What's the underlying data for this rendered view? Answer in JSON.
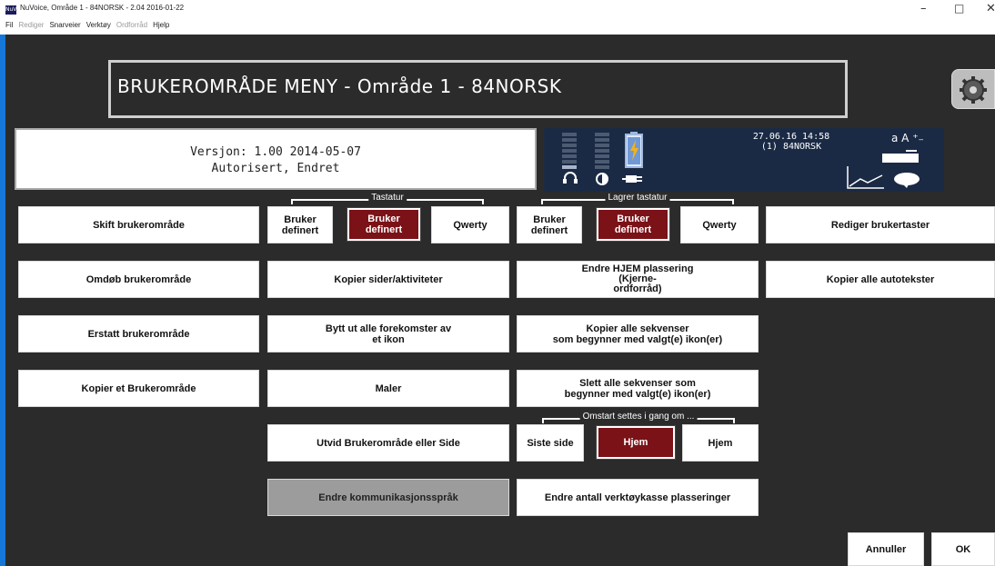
{
  "window": {
    "title": "NuVoice, Område 1 - 84NORSK - 2.04 2016-01-22",
    "icon_text": "NuV",
    "minimize": "–",
    "maximize": "□",
    "close": "✕"
  },
  "menubar": {
    "items": [
      "Fil",
      "Rediger",
      "Snarveier",
      "Verktøy",
      "Ordforråd",
      "Hjelp"
    ],
    "disabled": [
      "Rediger",
      "Ordforråd"
    ]
  },
  "header": {
    "title": "BRUKEROMRÅDE MENY - Område 1 - 84NORSK"
  },
  "version": {
    "line1": "Versjon: 1.00 2014-05-07",
    "line2": "Autorisert, Endret"
  },
  "status": {
    "date": "27.06.16 14:58",
    "user": "(1) 84NORSK",
    "size_icon": "a A ⁺₋"
  },
  "groups": {
    "tastatur": "Tastatur",
    "lagrer_tastatur": "Lagrer tastatur",
    "omstart": "Omstart settes i gang om ..."
  },
  "buttons": {
    "skift": "Skift brukerområde",
    "omdop": "Omdøb brukerområde",
    "erstatt": "Erstatt brukerområde",
    "kopier_omrade": "Kopier et Brukerområde",
    "t_bruker1": "Bruker\ndefinert",
    "t_bruker2": "Bruker\ndefinert",
    "t_qwerty": "Qwerty",
    "kopier_sider": "Kopier sider/aktiviteter",
    "bytt_ut": "Bytt ut alle forekomster av\net ikon",
    "maler": "Maler",
    "utvid": "Utvid Brukerområde eller Side",
    "endre_sprak": "Endre kommunikasjonsspråk",
    "l_bruker1": "Bruker\ndefinert",
    "l_bruker2": "Bruker\ndefinert",
    "l_qwerty": "Qwerty",
    "endre_hjem": "Endre HJEM plassering\n(Kjerne-\nordforråd)",
    "kopier_sekv": "Kopier alle sekvenser\nsom begynner med valgt(e) ikon(er)",
    "slett_sekv": "Slett alle sekvenser som\nbegynner med valgt(e) ikon(er)",
    "siste_side": "Siste side",
    "hjem1": "Hjem",
    "hjem2": "Hjem",
    "endre_antall": "Endre antall verktøykasse plasseringer",
    "rediger_taster": "Rediger brukertaster",
    "kopier_auto": "Kopier alle autotekster",
    "annuller": "Annuller",
    "ok": "OK"
  },
  "colors": {
    "selected": "#7a1218",
    "background": "#2b2b2b",
    "panel": "#1b2a44"
  }
}
